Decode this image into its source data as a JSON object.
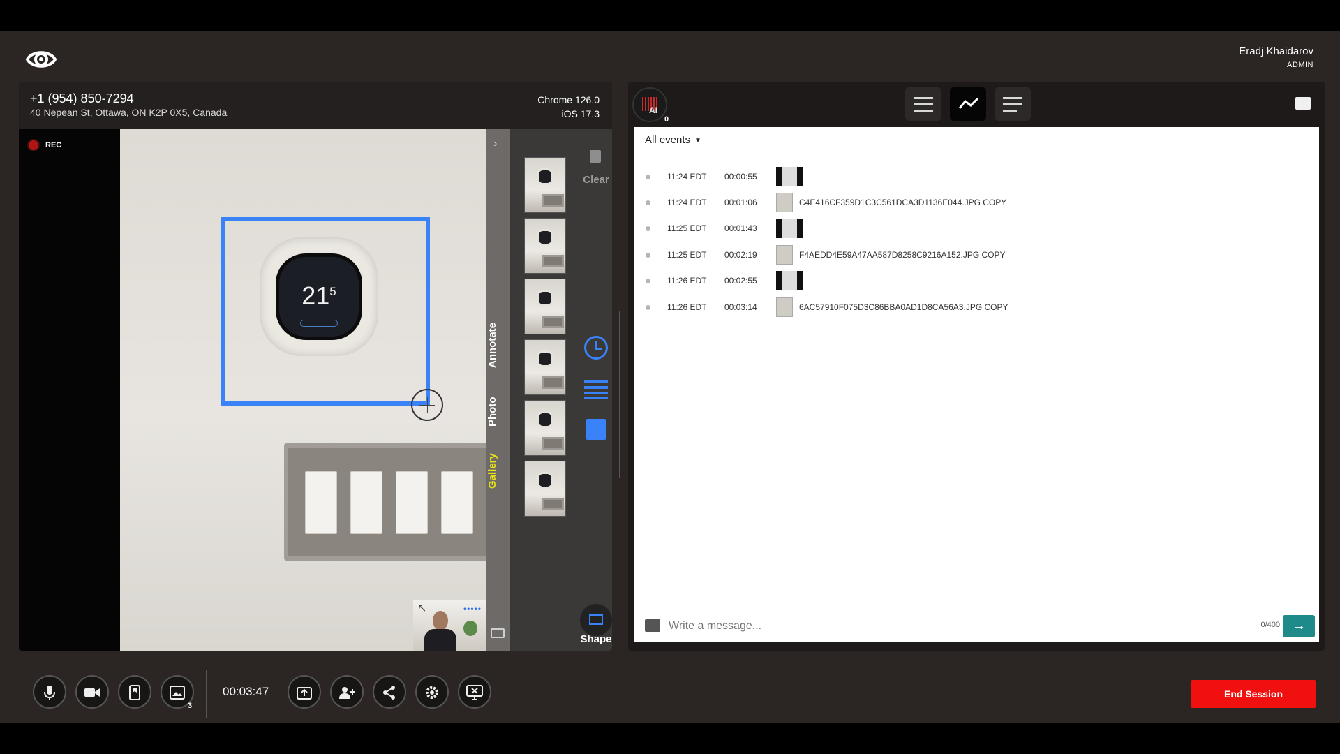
{
  "header": {
    "logo": "eye-icon",
    "user_name": "Eradj Khaidarov",
    "user_role": "ADMIN"
  },
  "caller": {
    "phone": "+1 (954) 850-7294",
    "address": "40 Nepean St, Ottawa, ON K2P 0X5, Canada",
    "browser": "Chrome 126.0",
    "os": "iOS 17.3"
  },
  "video": {
    "rec_label": "REC",
    "thermostat_temp": "21",
    "thermostat_temp_decimal": "5"
  },
  "side_tabs": {
    "annotate": "Annotate",
    "photo": "Photo",
    "gallery": "Gallery",
    "active": "Gallery"
  },
  "gallery_tools": {
    "clear_label": "Clear",
    "shape_label": "Shape",
    "accent_color": "#3a82f7"
  },
  "ai": {
    "count": "0",
    "label": "AI"
  },
  "events": {
    "filter_label": "All events",
    "items": [
      {
        "time": "11:24 EDT",
        "elapsed": "00:00:55",
        "filename": ""
      },
      {
        "time": "11:24 EDT",
        "elapsed": "00:01:06",
        "filename": "C4E416CF359D1C3C561DCA3D1136E044.JPG COPY"
      },
      {
        "time": "11:25 EDT",
        "elapsed": "00:01:43",
        "filename": ""
      },
      {
        "time": "11:25 EDT",
        "elapsed": "00:02:19",
        "filename": "F4AEDD4E59A47AA587D8258C9216A152.JPG COPY"
      },
      {
        "time": "11:26 EDT",
        "elapsed": "00:02:55",
        "filename": ""
      },
      {
        "time": "11:26 EDT",
        "elapsed": "00:03:14",
        "filename": "6AC57910F075D3C86BBA0AD1D8CA56A3.JPG COPY"
      }
    ]
  },
  "message": {
    "placeholder": "Write a message...",
    "counter": "0/400"
  },
  "controls": {
    "gallery_badge": "3",
    "timer": "00:03:47",
    "end_label": "End Session",
    "end_color": "#f0100f"
  }
}
